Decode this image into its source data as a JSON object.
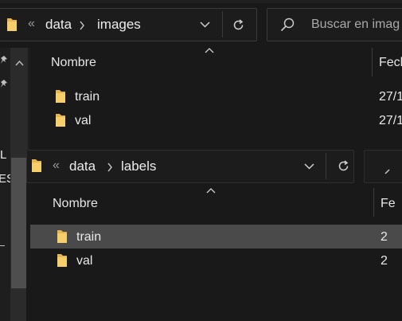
{
  "back_window": {
    "address": {
      "overflow_icon": "«",
      "segments": [
        "data",
        "images"
      ],
      "separator": ">"
    },
    "search_placeholder": "Buscar en imag",
    "header": {
      "name": "Nombre",
      "date": "Fech"
    },
    "rows": [
      {
        "name": "train",
        "date": "27/1"
      },
      {
        "name": "val",
        "date": "27/1"
      }
    ],
    "side_fragments": [
      "L",
      "ES"
    ]
  },
  "front_window": {
    "address": {
      "overflow_icon": "«",
      "segments": [
        "data",
        "labels"
      ],
      "separator": ">"
    },
    "header": {
      "name": "Nombre",
      "date": "Fe"
    },
    "rows": [
      {
        "name": "train",
        "date": "2",
        "selected": true
      },
      {
        "name": "val",
        "date": "2",
        "selected": false
      }
    ]
  },
  "colors": {
    "background": "#191919",
    "selection": "#4a4a4a",
    "folder": "#f2c55c"
  },
  "icons": [
    "folder-icon",
    "chevron-down-icon",
    "refresh-icon",
    "search-icon",
    "pin-icon",
    "sort-up-icon"
  ]
}
